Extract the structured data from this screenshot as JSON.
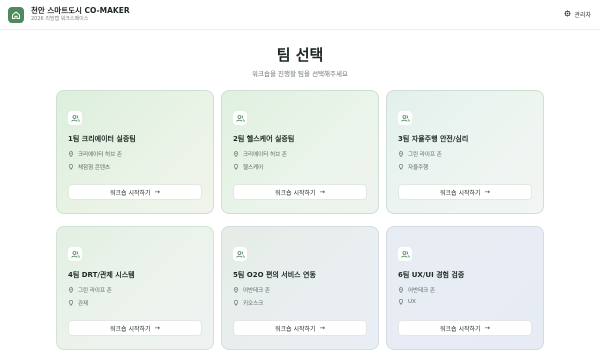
{
  "header": {
    "title": "천안 스마트도시 CO-MAKER",
    "subtitle": "2026 리빙랩 워크스페이스",
    "admin_label": "관리자"
  },
  "page": {
    "title": "팀 선택",
    "subtitle": "워크숍을 진행할 팀을 선택해주세요"
  },
  "teams": [
    {
      "title": "1팀 크리에이터 실증팀",
      "zone": "크리에이터 허브 존",
      "topic": "체험형 콘텐츠",
      "button": "워크숍 시작하기"
    },
    {
      "title": "2팀 헬스케어 실증팀",
      "zone": "크리에이터 허브 존",
      "topic": "헬스케어",
      "button": "워크숍 시작하기"
    },
    {
      "title": "3팀 자율주행 안전/심리",
      "zone": "그린 라이프 존",
      "topic": "자율주행",
      "button": "워크숍 시작하기"
    },
    {
      "title": "4팀 DRT/관제 시스템",
      "zone": "그린 라이프 존",
      "topic": "관제",
      "button": "워크숍 시작하기"
    },
    {
      "title": "5팀 O2O 편의 서비스 연동",
      "zone": "어반테크 존",
      "topic": "키오스크",
      "button": "워크숍 시작하기"
    },
    {
      "title": "6팀 UX/UI 경험 검증",
      "zone": "어반테크 존",
      "topic": "UX",
      "button": "워크숍 시작하기"
    }
  ],
  "colors": {
    "accent": "#4f8a5c",
    "text_primary": "#1e2823",
    "text_secondary": "#5d6862"
  },
  "icons": {
    "logo": "home-icon",
    "admin": "gear-icon",
    "team": "users-icon",
    "zone": "map-pin-icon",
    "topic": "lightbulb-icon",
    "button": "arrow-right-icon"
  }
}
